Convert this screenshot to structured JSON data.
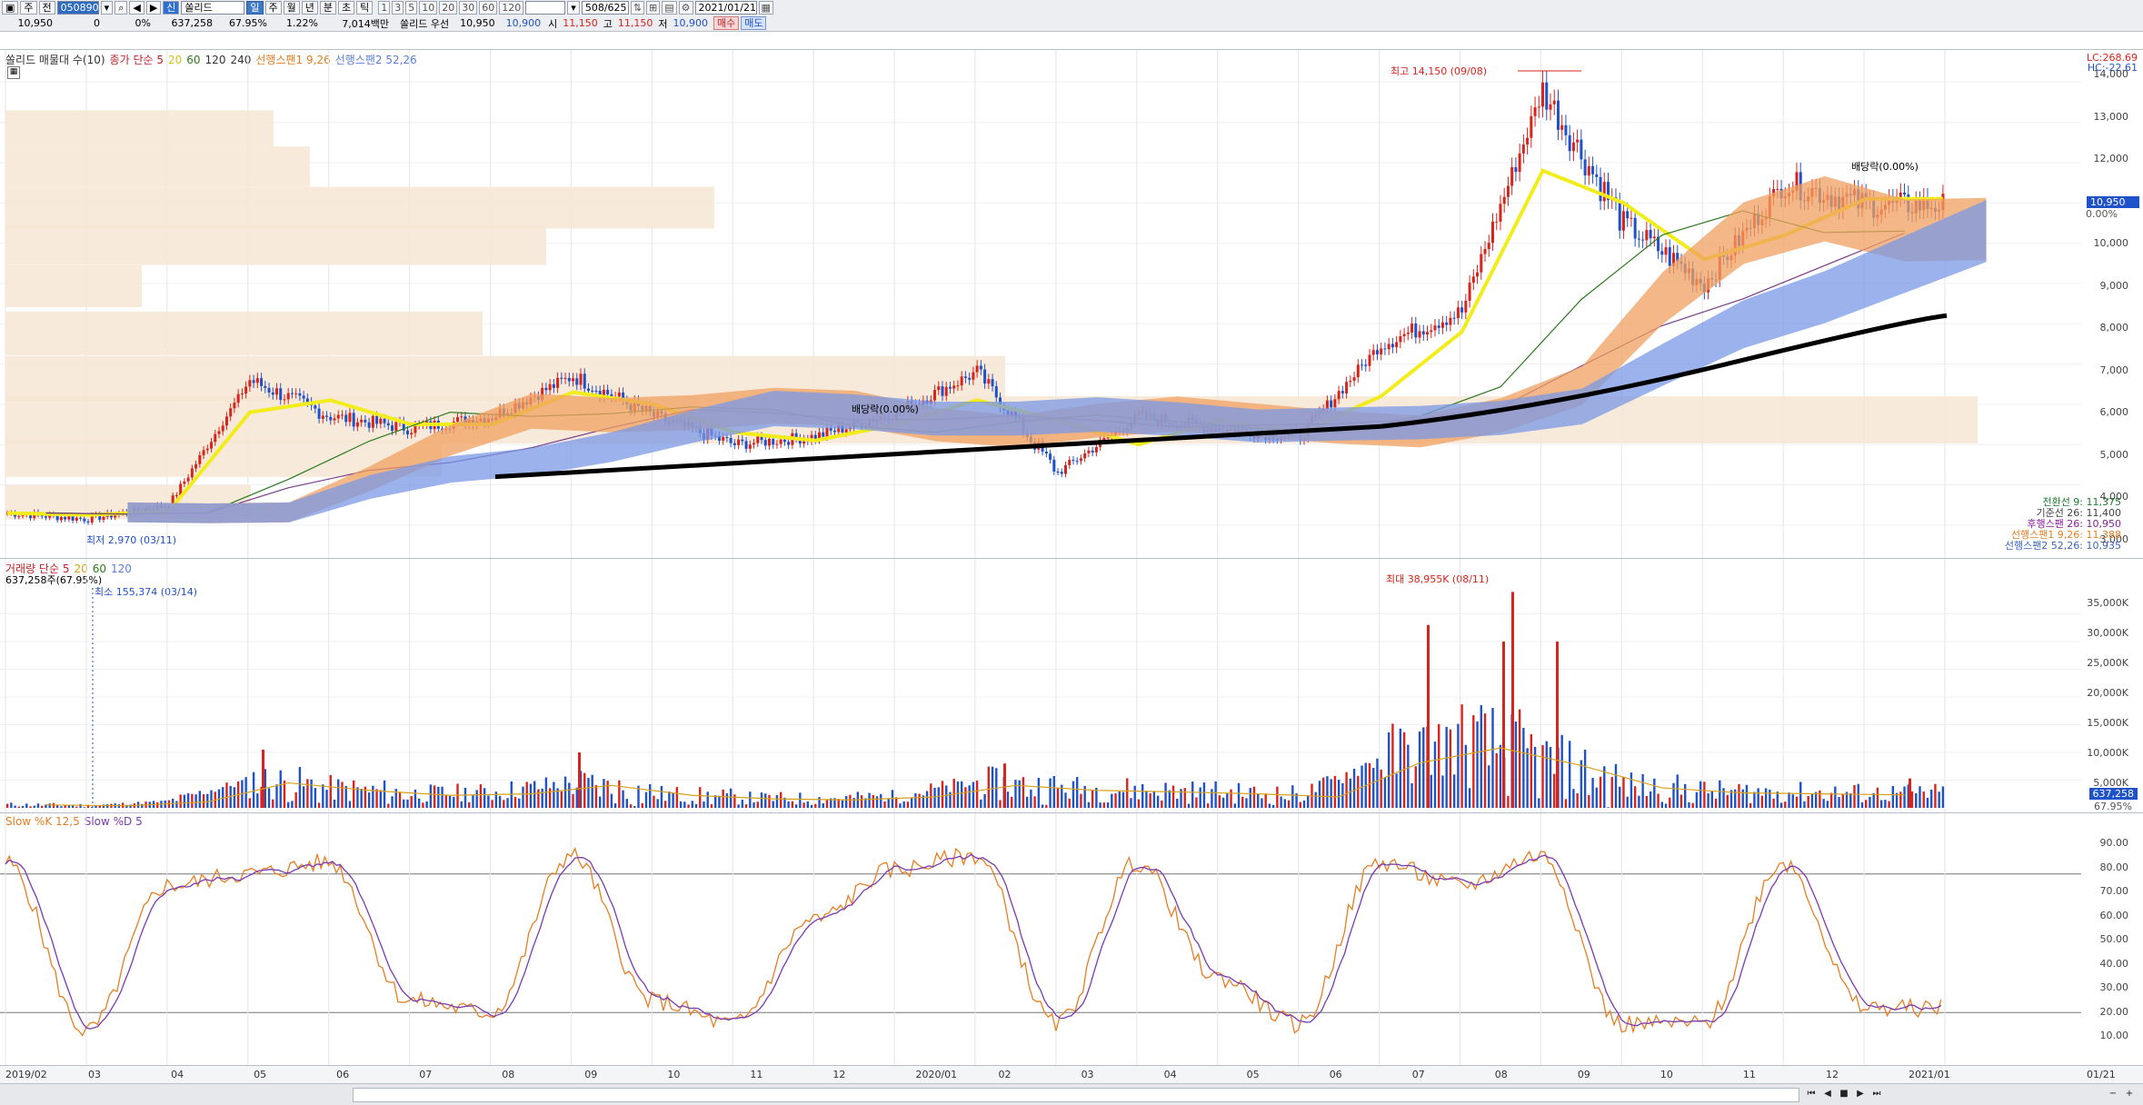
{
  "toolbar": {
    "row1": {
      "period_icon": "▣",
      "type_label": "주",
      "range_label": "전",
      "code": "050890",
      "search_icon": "search",
      "nav_label": "◀",
      "nav_next": "▶",
      "nav_down": "▾",
      "market_badge": "신",
      "name": "쏠리드",
      "kind_label": "일",
      "periods": [
        "주",
        "월",
        "년",
        "분",
        "초",
        "틱"
      ],
      "numbers": [
        "1",
        "3",
        "5",
        "10",
        "20",
        "30",
        "60",
        "120"
      ],
      "count": "508/625",
      "date": "2021/01/21"
    },
    "row2": {
      "price": "10,950",
      "change": "0",
      "change_pct": "0%",
      "volume": "637,258",
      "volume_ratio": "67.95%",
      "turnover": "1.22%",
      "amount": "7,014백만",
      "name2": "쏠리드 우선",
      "p_close": "10,950",
      "p_prev": "10,900",
      "open_label": "시",
      "open": "11,150",
      "high_label": "고",
      "high": "11,150",
      "low_label": "저",
      "low": "10,900",
      "buy": "매수",
      "sell": "매도"
    }
  },
  "price_panel": {
    "legend": [
      {
        "text": "쏠리드 매물대 수(10)",
        "color": "#333333"
      },
      {
        "text": "종가 단순 5",
        "color": "#c0242b"
      },
      {
        "text": "20",
        "color": "#d8c21a"
      },
      {
        "text": "60",
        "color": "#2c7a1e"
      },
      {
        "text": "120",
        "color": "#333333"
      },
      {
        "text": "240",
        "color": "#333333"
      },
      {
        "text": "선행스팬1 9,26",
        "color": "#e67e22"
      },
      {
        "text": "선행스팬2 52,26",
        "color": "#5a7fd6"
      }
    ],
    "lc": "LC:268.69",
    "hc": "HC:-22.61",
    "y_ticks": [
      "14,000",
      "13,000",
      "12,000",
      "11,000",
      "10,000",
      "9,000",
      "8,000",
      "7,000",
      "6,000",
      "5,000",
      "4,000",
      "3,000"
    ],
    "price_tag": "10,950",
    "price_tag_pct": "0.00%",
    "high_ann": "최고 14,150 (09/08)",
    "low_ann": "최저 2,970 (03/11)",
    "dividend1": "배당락(0.00%)",
    "dividend2": "배당락(0.00%)",
    "ichimoku": [
      {
        "text": "전환선 9: 11,375",
        "color": "#1c7a2a"
      },
      {
        "text": "기준선 26: 11,400",
        "color": "#444444"
      },
      {
        "text": "후행스팬 26: 10,950",
        "color": "#8a1aa0"
      },
      {
        "text": "선행스팬1 9,26: 11,388",
        "color": "#e67e22"
      },
      {
        "text": "선행스팬2 52,26: 10,935",
        "color": "#3a64c4"
      }
    ]
  },
  "volume_panel": {
    "legend": [
      {
        "text": "거래량 단순 5",
        "color": "#c0242b"
      },
      {
        "text": "20",
        "color": "#d8a01a"
      },
      {
        "text": "60",
        "color": "#2c7a1e"
      },
      {
        "text": "120",
        "color": "#5a7fd6"
      }
    ],
    "sub": "637,258주(67.95%)",
    "min_ann": "최소 155,374 (03/14)",
    "max_ann": "최대 38,955K (08/11)",
    "y_ticks": [
      "35,000K",
      "30,000K",
      "25,000K",
      "20,000K",
      "15,000K",
      "10,000K",
      "5,000K"
    ],
    "tag": "637,258",
    "tag_pct": "67.95%"
  },
  "stoch_panel": {
    "legend": [
      {
        "text": "Slow %K 12,5",
        "color": "#e67e22"
      },
      {
        "text": "Slow %D 5",
        "color": "#7a3ab0"
      }
    ],
    "y_ticks": [
      "90.00",
      "80.00",
      "70.00",
      "60.00",
      "50.00",
      "40.00",
      "30.00",
      "20.00",
      "10.00"
    ]
  },
  "x_axis": [
    "2019/02",
    "03",
    "04",
    "05",
    "06",
    "07",
    "08",
    "09",
    "10",
    "11",
    "12",
    "2020/01",
    "02",
    "03",
    "04",
    "05",
    "06",
    "07",
    "08",
    "09",
    "10",
    "11",
    "12",
    "2021/01",
    "01/21"
  ],
  "chart_data": {
    "type": "line",
    "title": "",
    "price_ylim": [
      2500,
      14300
    ],
    "volume_ylim": [
      0,
      40000
    ],
    "stoch_ylim": [
      0,
      100
    ],
    "months": [
      "2019/02",
      "03",
      "04",
      "05",
      "06",
      "07",
      "08",
      "09",
      "10",
      "11",
      "12",
      "2020/01",
      "02",
      "03",
      "04",
      "05",
      "06",
      "07",
      "08",
      "09",
      "10",
      "11",
      "12",
      "2021/01"
    ],
    "close_monthly": [
      3300,
      3150,
      3500,
      6600,
      5700,
      5400,
      5700,
      6700,
      5700,
      5000,
      5200,
      5800,
      6800,
      4300,
      5700,
      5400,
      5200,
      7500,
      8300,
      13800,
      10500,
      9000,
      11500,
      10950
    ],
    "ma20_monthly": [
      3300,
      3250,
      3350,
      5800,
      6100,
      5500,
      5500,
      6300,
      6000,
      5300,
      5100,
      5500,
      6100,
      5600,
      5000,
      5600,
      5300,
      6200,
      7800,
      11800,
      11000,
      9600,
      10200,
      11100
    ],
    "volume_monthly_k": [
      600,
      400,
      1200,
      5000,
      3500,
      2500,
      2800,
      4500,
      2500,
      1800,
      1600,
      2200,
      4500,
      3500,
      3200,
      2800,
      2200,
      9000,
      12000,
      8500,
      4000,
      3000,
      2800,
      2600
    ],
    "slow_k_monthly": [
      85,
      12,
      75,
      80,
      85,
      25,
      20,
      88,
      25,
      15,
      60,
      82,
      88,
      15,
      85,
      35,
      15,
      85,
      75,
      88,
      15,
      15,
      85,
      22
    ],
    "high": 14150,
    "low": 2970,
    "last": 10950
  }
}
